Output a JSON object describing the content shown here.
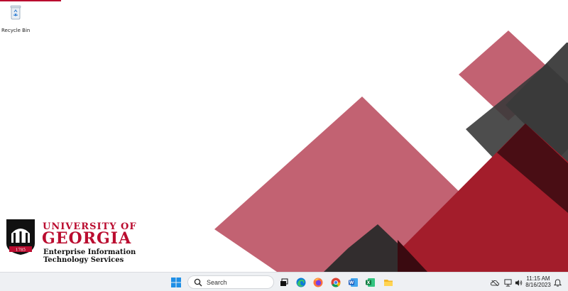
{
  "desktop": {
    "icons": [
      {
        "label": "Recycle Bin",
        "icon": "recycle-bin-icon"
      }
    ]
  },
  "wallpaper": {
    "logo": {
      "line1": "UNIVERSITY OF",
      "line2": "GEORGIA",
      "line3": "Enterprise Information",
      "line4": "Technology Services",
      "seal_year": "1785"
    },
    "colors": {
      "brand_red": "#ba0c2f",
      "rose": "#bf5a6a",
      "dark_gray": "#3a3a3a",
      "dark_maroon": "#3a0a10"
    }
  },
  "taskbar": {
    "search_placeholder": "Search",
    "apps": [
      {
        "name": "start",
        "icon": "windows-logo-icon"
      },
      {
        "name": "task-view",
        "icon": "task-view-icon"
      },
      {
        "name": "edge",
        "icon": "edge-icon"
      },
      {
        "name": "firefox",
        "icon": "firefox-icon"
      },
      {
        "name": "chrome",
        "icon": "chrome-icon"
      },
      {
        "name": "word",
        "icon": "word-icon"
      },
      {
        "name": "excel",
        "icon": "excel-icon"
      },
      {
        "name": "file-explorer",
        "icon": "folder-icon"
      }
    ],
    "tray": {
      "time": "11:15 AM",
      "date": "8/16/2023"
    }
  }
}
